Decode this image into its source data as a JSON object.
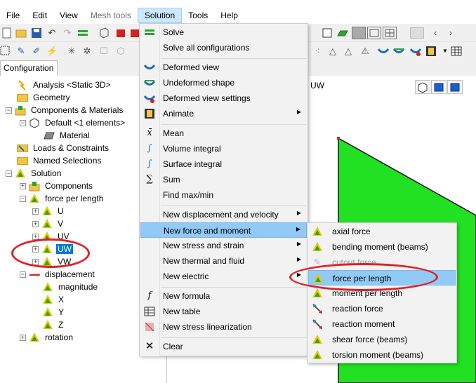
{
  "menubar": {
    "items": [
      {
        "label": "File",
        "state": "normal"
      },
      {
        "label": "Edit",
        "state": "normal"
      },
      {
        "label": "View",
        "state": "normal"
      },
      {
        "label": "Mesh tools",
        "state": "disabled"
      },
      {
        "label": "Solution",
        "state": "active"
      },
      {
        "label": "Tools",
        "state": "normal"
      },
      {
        "label": "Help",
        "state": "normal"
      }
    ]
  },
  "panel": {
    "tab_label": "Configuration"
  },
  "tree": {
    "rows": [
      {
        "label": "Analysis <Static 3D>",
        "icon": "analysis-icon"
      },
      {
        "label": "Geometry",
        "icon": "folder-icon"
      },
      {
        "label": "Components & Materials",
        "icon": "components-icon"
      },
      {
        "label": "Default <1 elements>",
        "icon": "default-icon"
      },
      {
        "label": "Material",
        "icon": "material-icon"
      },
      {
        "label": "Loads & Constraints",
        "icon": "loads-icon"
      },
      {
        "label": "Named Selections",
        "icon": "folder-icon"
      },
      {
        "label": "Solution",
        "icon": "solution-icon"
      },
      {
        "label": "Components",
        "icon": "folder-icon"
      },
      {
        "label": "force per length",
        "icon": "result-icon"
      },
      {
        "label": "U",
        "icon": "result-icon"
      },
      {
        "label": "V",
        "icon": "result-icon"
      },
      {
        "label": "UV",
        "icon": "result-icon"
      },
      {
        "label": "UW",
        "icon": "result-icon",
        "selected": true
      },
      {
        "label": "VW",
        "icon": "result-icon"
      },
      {
        "label": "displacement",
        "icon": "displacement-icon"
      },
      {
        "label": "magnitude",
        "icon": "result-icon"
      },
      {
        "label": "X",
        "icon": "result-icon"
      },
      {
        "label": "Y",
        "icon": "result-icon"
      },
      {
        "label": "Z",
        "icon": "result-icon"
      },
      {
        "label": "rotation",
        "icon": "result-icon"
      }
    ]
  },
  "canvas": {
    "title": "UW",
    "shape_color": "#22e022"
  },
  "solution_menu": {
    "items": [
      {
        "label": "Solve",
        "icon": "solve-icon",
        "submenu": false
      },
      {
        "label": "Solve all configurations",
        "icon": "",
        "submenu": false
      },
      {
        "label": "Deformed view",
        "icon": "deformed-view-icon",
        "submenu": false
      },
      {
        "label": "Undeformed shape",
        "icon": "undeformed-shape-icon",
        "submenu": false
      },
      {
        "label": "Deformed view settings",
        "icon": "deformed-settings-icon",
        "submenu": false
      },
      {
        "label": "Animate",
        "icon": "animate-icon",
        "submenu": true
      },
      {
        "label": "Mean",
        "icon": "mean-icon",
        "submenu": false
      },
      {
        "label": "Volume integral",
        "icon": "volume-integral-icon",
        "submenu": false
      },
      {
        "label": "Surface integral",
        "icon": "surface-integral-icon",
        "submenu": false
      },
      {
        "label": "Sum",
        "icon": "sum-icon",
        "submenu": false
      },
      {
        "label": "Find max/min",
        "icon": "",
        "submenu": false
      },
      {
        "label": "New displacement and velocity",
        "icon": "",
        "submenu": true
      },
      {
        "label": "New force and moment",
        "icon": "",
        "submenu": true,
        "highlight": true
      },
      {
        "label": "New stress and strain",
        "icon": "",
        "submenu": true
      },
      {
        "label": "New thermal and fluid",
        "icon": "",
        "submenu": true
      },
      {
        "label": "New electric",
        "icon": "",
        "submenu": true
      },
      {
        "label": "New formula",
        "icon": "formula-icon",
        "submenu": false
      },
      {
        "label": "New table",
        "icon": "table-icon",
        "submenu": false
      },
      {
        "label": "New stress linearization",
        "icon": "stress-linearization-icon",
        "submenu": false
      },
      {
        "label": "Clear",
        "icon": "clear-icon",
        "submenu": false
      }
    ]
  },
  "force_submenu": {
    "items": [
      {
        "label": "axial force",
        "icon": "result-icon"
      },
      {
        "label": "bending moment (beams)",
        "icon": "result-icon"
      },
      {
        "label": "cutout force",
        "icon": "cutout-icon"
      },
      {
        "label": "force per length",
        "icon": "result-icon",
        "highlight": true
      },
      {
        "label": "moment per length",
        "icon": "result-icon"
      },
      {
        "label": "reaction force",
        "icon": "reaction-icon"
      },
      {
        "label": "reaction moment",
        "icon": "reaction-icon"
      },
      {
        "label": "shear force (beams)",
        "icon": "result-icon"
      },
      {
        "label": "torsion moment (beams)",
        "icon": "result-icon"
      }
    ]
  },
  "colors": {
    "highlight": "#91c9f7",
    "selected": "#0078d7",
    "annotation": "#e0202a"
  }
}
